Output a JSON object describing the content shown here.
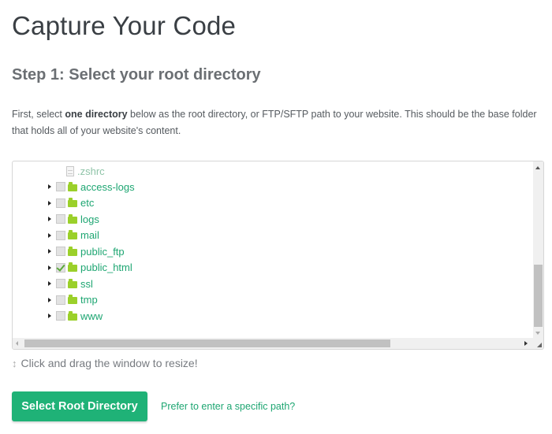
{
  "page": {
    "title": "Capture Your Code",
    "step_title": "Step 1: Select your root directory",
    "intro": {
      "before": "First, select ",
      "bold": "one directory",
      "after": " below as the root directory, or FTP/SFTP path to your website. This should be the base folder that holds all of your website's content."
    }
  },
  "tree": {
    "file": {
      "name": ".zshrc",
      "icon": "file-icon"
    },
    "folders": [
      {
        "name": "access-logs",
        "checked": false
      },
      {
        "name": "etc",
        "checked": false
      },
      {
        "name": "logs",
        "checked": false
      },
      {
        "name": "mail",
        "checked": false
      },
      {
        "name": "public_ftp",
        "checked": false
      },
      {
        "name": "public_html",
        "checked": true
      },
      {
        "name": "ssl",
        "checked": false
      },
      {
        "name": "tmp",
        "checked": false
      },
      {
        "name": "www",
        "checked": false
      }
    ]
  },
  "hint": {
    "icon": "resize-vertical-icon",
    "glyph": "↕",
    "text": "Click and drag the window to resize!"
  },
  "actions": {
    "select_button": "Select Root Directory",
    "path_link": "Prefer to enter a specific path?"
  },
  "colors": {
    "accent": "#1fb277",
    "link": "#1ea672",
    "folder": "#9bd02a"
  }
}
